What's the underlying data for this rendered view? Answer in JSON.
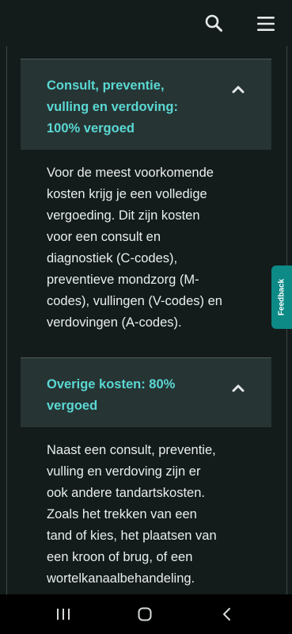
{
  "header": {
    "search_icon": "search-icon",
    "menu_icon": "hamburger-menu-icon"
  },
  "sections": [
    {
      "title_lines": [
        "Consult, preventie,",
        "vulling en verdoving:",
        "100% vergoed"
      ],
      "expanded": true,
      "body_lines": [
        "Voor de meest voorkomende",
        "kosten krijg je een volledige",
        "vergoeding. Dit zijn kosten",
        "voor een consult en",
        "diagnostiek (C-codes),",
        "preventieve mondzorg (M-",
        "codes), vullingen (V-codes) en",
        "verdovingen (A-codes)."
      ]
    },
    {
      "title_lines": [
        "Overige kosten: 80%",
        "vergoed"
      ],
      "expanded": true,
      "body_lines": [
        "Naast een consult, preventie,",
        "vulling en verdoving zijn er",
        "ook andere tandartskosten.",
        "Zoals het trekken van een",
        "tand of kies, het plaatsen van",
        "een kroon of brug, of een",
        "wortelkanaalbehandeling."
      ]
    }
  ],
  "feedback": {
    "label": "Feedback"
  },
  "colors": {
    "background": "#141b1b",
    "panel": "#273434",
    "accent": "#5ad8d3",
    "feedback": "#0d8a86"
  }
}
